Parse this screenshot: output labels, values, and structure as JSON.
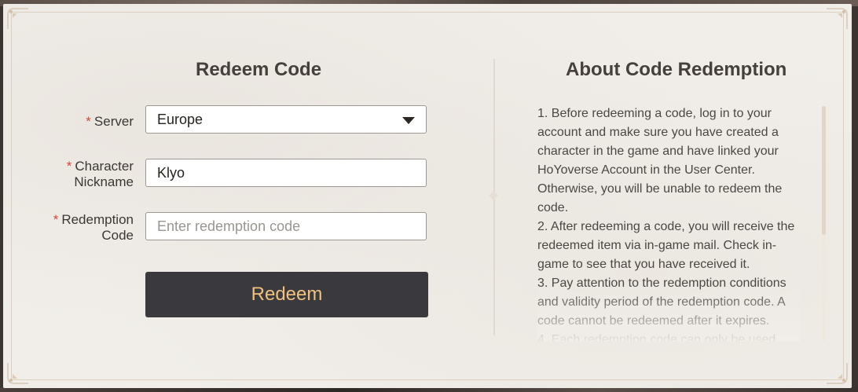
{
  "redeem": {
    "title": "Redeem Code",
    "server_label": "Server",
    "server_value": "Europe",
    "nickname_label_line1": "Character",
    "nickname_label_line2": "Nickname",
    "nickname_value": "Klyo",
    "code_label_line1": "Redemption",
    "code_label_line2": "Code",
    "code_placeholder": "Enter redemption code",
    "required_mark": "*",
    "button_label": "Redeem"
  },
  "about": {
    "title": "About Code Redemption",
    "paragraphs": [
      "1. Before redeeming a code, log in to your account and make sure you have created a character in the game and have linked your HoYoverse Account in the User Center. Otherwise, you will be unable to redeem the code.",
      "2. After redeeming a code, you will receive the redeemed item via in-game mail. Check in-game to see that you have received it.",
      "3. Pay attention to the redemption conditions and validity period of the redemption code. A code cannot be redeemed after it expires.",
      "4. Each redemption code can only be used"
    ]
  },
  "colors": {
    "panel_bg": "#f1eeea",
    "button_bg": "#3a3a3e",
    "button_text": "#f0c07d",
    "required": "#d3473b"
  },
  "icons": {
    "select_caret": "chevron-down-icon",
    "corner_ornament": "corner-ornament-icon"
  }
}
